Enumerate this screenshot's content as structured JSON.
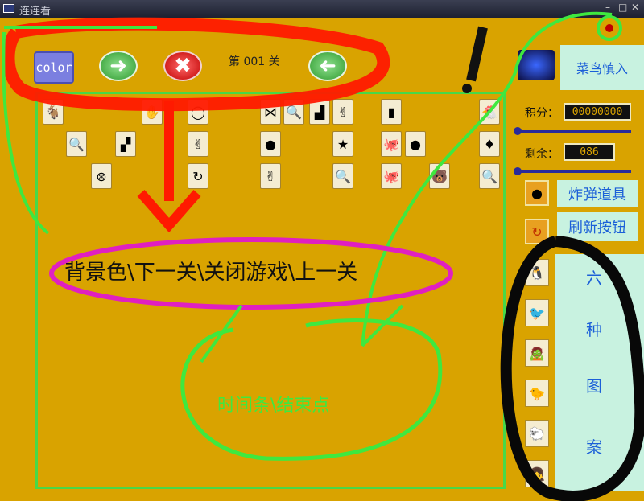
{
  "window": {
    "title": "连连看"
  },
  "toolbar": {
    "color_label": "color",
    "level_text": "第 001 关"
  },
  "side": {
    "player_name": "菜鸟慎入",
    "score_label": "积分：",
    "score_value": "00000000",
    "remain_label": "剩余：",
    "remain_value": "086",
    "bomb_label": "炸弹道具",
    "refresh_label": "刷新按钮",
    "pattern_text": [
      "六",
      "种",
      "图",
      "案"
    ]
  },
  "annotations": {
    "toolbar_note": "背景色\\下一关\\关闭游戏\\上一关",
    "timebar_note": "时间条\\结束点"
  },
  "colors": {
    "background": "#d9a300",
    "panel": "#c8f2e0",
    "panel_text": "#1b5fd8",
    "annotation_red": "#ff1a00",
    "annotation_green": "#3fe83f",
    "annotation_magenta": "#e020c0"
  },
  "tiles": [
    {
      "c": "goat",
      "g": "🐐"
    },
    {
      "c": "goat",
      "g": "🐐"
    },
    {
      "c": "hand",
      "g": "✋"
    },
    {
      "c": "pearl",
      "g": "◯"
    },
    {
      "c": "bow",
      "g": "⋈"
    },
    {
      "c": "mag",
      "g": "🔍"
    },
    {
      "c": "tetris",
      "g": "▟"
    },
    {
      "c": "peace",
      "g": "✌"
    },
    {
      "c": "bar",
      "g": "▮"
    },
    {
      "c": "chicken",
      "g": "🐔"
    },
    {
      "c": "mag",
      "g": "🔍"
    },
    {
      "c": "tetris",
      "g": "▞"
    },
    {
      "c": "peace",
      "g": "✌"
    },
    {
      "c": "ball",
      "g": "●"
    },
    {
      "c": "star",
      "g": "★"
    },
    {
      "c": "octo",
      "g": "🐙"
    },
    {
      "c": "ball",
      "g": "●"
    },
    {
      "c": "diamond",
      "g": "♦"
    },
    {
      "c": "clock",
      "g": "⊛"
    },
    {
      "c": "refresh",
      "g": "↻"
    },
    {
      "c": "peace",
      "g": "✌"
    },
    {
      "c": "mag",
      "g": "🔍"
    },
    {
      "c": "octo",
      "g": "🐙"
    },
    {
      "c": "bear",
      "g": "🐻"
    },
    {
      "c": "mag",
      "g": "🔍"
    }
  ],
  "patterns": [
    "🐧",
    "🐦",
    "🧟",
    "🐤",
    "🐑",
    "👧"
  ]
}
